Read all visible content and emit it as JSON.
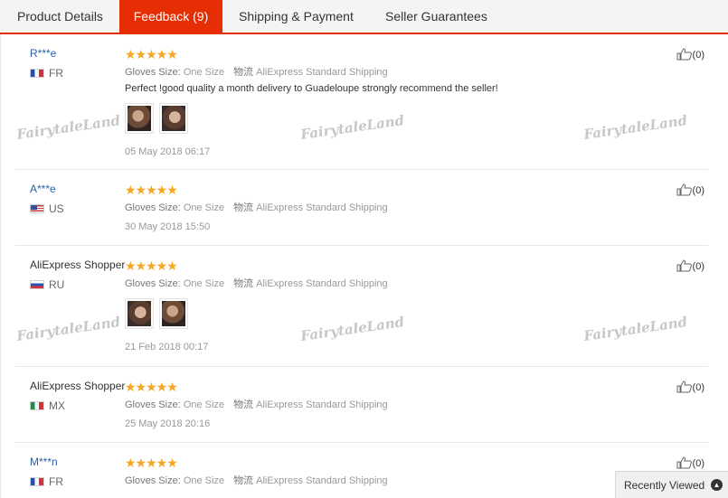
{
  "tabs": [
    "Product Details",
    "Feedback (9)",
    "Shipping & Payment",
    "Seller Guarantees"
  ],
  "watermark": "FairytaleLand",
  "stars": "★★★★★",
  "reviews": [
    {
      "user": "R***e",
      "flag": "fr",
      "country": "FR",
      "size_label": "Gloves Size:",
      "size_value": "One Size",
      "ship_label": "物流",
      "ship_value": "AliExpress Standard Shipping",
      "text": "Perfect !good quality a month delivery to Guadeloupe strongly recommend the seller!",
      "photos": 2,
      "date": "05 May 2018 06:17",
      "likes": "(0)"
    },
    {
      "user": "A***e",
      "flag": "us",
      "country": "US",
      "size_label": "Gloves Size:",
      "size_value": "One Size",
      "ship_label": "物流",
      "ship_value": "AliExpress Standard Shipping",
      "date": "30 May 2018 15:50",
      "likes": "(0)"
    },
    {
      "user": "AliExpress Shopper",
      "flag": "ru",
      "country": "RU",
      "size_label": "Gloves Size:",
      "size_value": "One Size",
      "ship_label": "物流",
      "ship_value": "AliExpress Standard Shipping",
      "photos": 2,
      "date": "21 Feb 2018 00:17",
      "likes": "(0)"
    },
    {
      "user": "AliExpress Shopper",
      "flag": "mx",
      "country": "MX",
      "size_label": "Gloves Size:",
      "size_value": "One Size",
      "ship_label": "物流",
      "ship_value": "AliExpress Standard Shipping",
      "date": "25 May 2018 20:16",
      "likes": "(0)"
    },
    {
      "user": "M***n",
      "flag": "fr",
      "country": "FR",
      "size_label": "Gloves Size:",
      "size_value": "One Size",
      "ship_label": "物流",
      "ship_value": "AliExpress Standard Shipping",
      "likes": "(0)"
    }
  ],
  "recently_viewed": "Recently Viewed",
  "colors": {
    "accent": "#e62e04",
    "star": "#f5a623",
    "link": "#2a62a6"
  }
}
